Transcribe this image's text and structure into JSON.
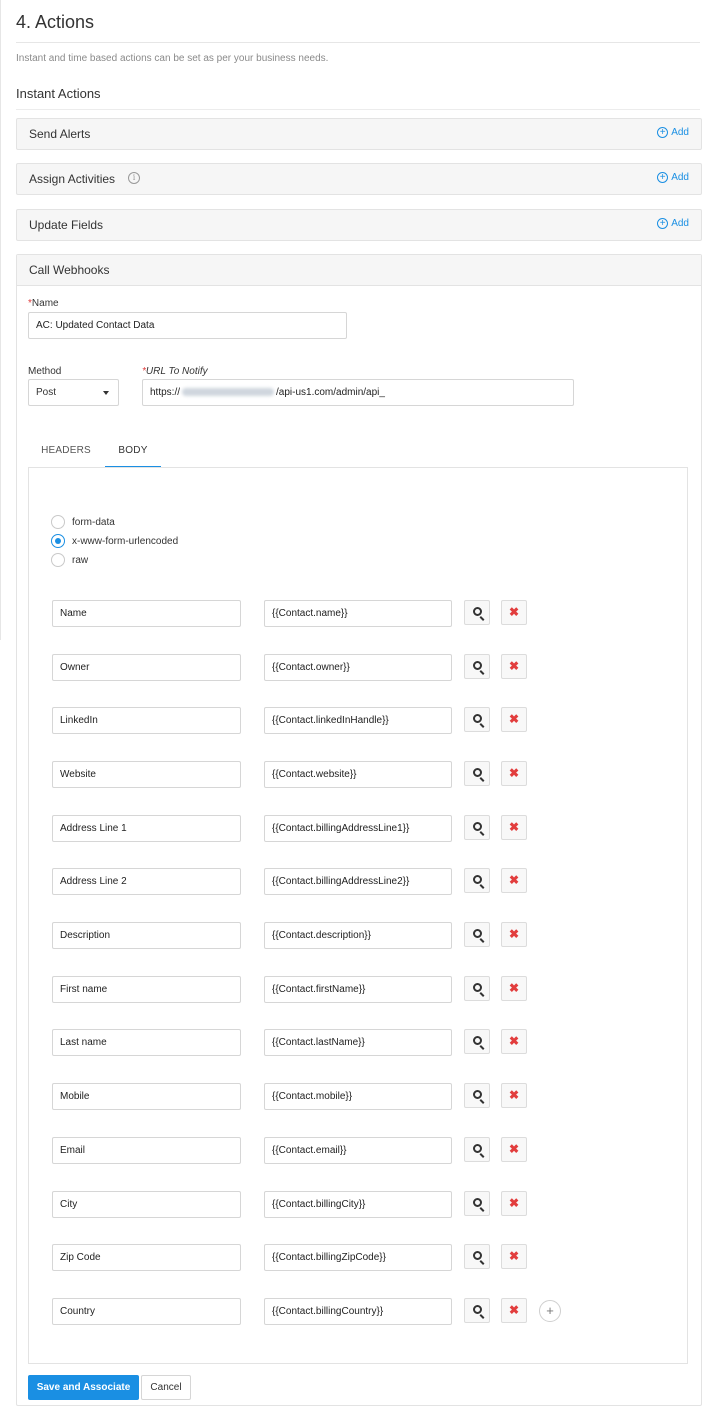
{
  "header": {
    "title": "4. Actions",
    "subtitle": "Instant and time based actions can be set as per your business needs."
  },
  "instant_actions": {
    "heading": "Instant Actions",
    "add_label": "Add",
    "sections": [
      {
        "label": "Send Alerts"
      },
      {
        "label": "Assign Activities"
      },
      {
        "label": "Update Fields"
      }
    ]
  },
  "webhook": {
    "title": "Call Webhooks",
    "name_label": "Name",
    "required_mark": "*",
    "name_value": "AC: Updated Contact Data",
    "method_label": "Method",
    "method_value": "Post",
    "url_label": "URL To Notify",
    "url_prefix": "https://",
    "url_suffix": "/api-us1.com/admin/api_",
    "tabs": [
      {
        "label": "HEADERS",
        "active": false
      },
      {
        "label": "BODY",
        "active": true
      }
    ],
    "body_types": [
      {
        "label": "form-data",
        "checked": false
      },
      {
        "label": "x-www-form-urlencoded",
        "checked": true
      },
      {
        "label": "raw",
        "checked": false
      }
    ],
    "rows": [
      {
        "key": "Name",
        "value": "{{Contact.name}}"
      },
      {
        "key": "Owner",
        "value": "{{Contact.owner}}"
      },
      {
        "key": "LinkedIn",
        "value": "{{Contact.linkedInHandle}}"
      },
      {
        "key": "Website",
        "value": "{{Contact.website}}"
      },
      {
        "key": "Address Line 1",
        "value": "{{Contact.billingAddressLine1}}"
      },
      {
        "key": "Address Line 2",
        "value": "{{Contact.billingAddressLine2}}"
      },
      {
        "key": "Description",
        "value": "{{Contact.description}}"
      },
      {
        "key": "First name",
        "value": "{{Contact.firstName}}"
      },
      {
        "key": "Last name",
        "value": "{{Contact.lastName}}"
      },
      {
        "key": "Mobile",
        "value": "{{Contact.mobile}}"
      },
      {
        "key": "Email",
        "value": "{{Contact.email}}"
      },
      {
        "key": "City",
        "value": "{{Contact.billingCity}}"
      },
      {
        "key": "Zip Code",
        "value": "{{Contact.billingZipCode}}"
      },
      {
        "key": "Country",
        "value": "{{Contact.billingCountry}}"
      }
    ]
  },
  "footer": {
    "save_label": "Save and Associate",
    "cancel_label": "Cancel"
  },
  "colors": {
    "accent": "#1a8fe3",
    "danger": "#e23d3d"
  },
  "icons": [
    "info-icon",
    "add-circle-icon",
    "caret-down-icon",
    "search-icon",
    "delete-icon",
    "add-row-icon"
  ]
}
